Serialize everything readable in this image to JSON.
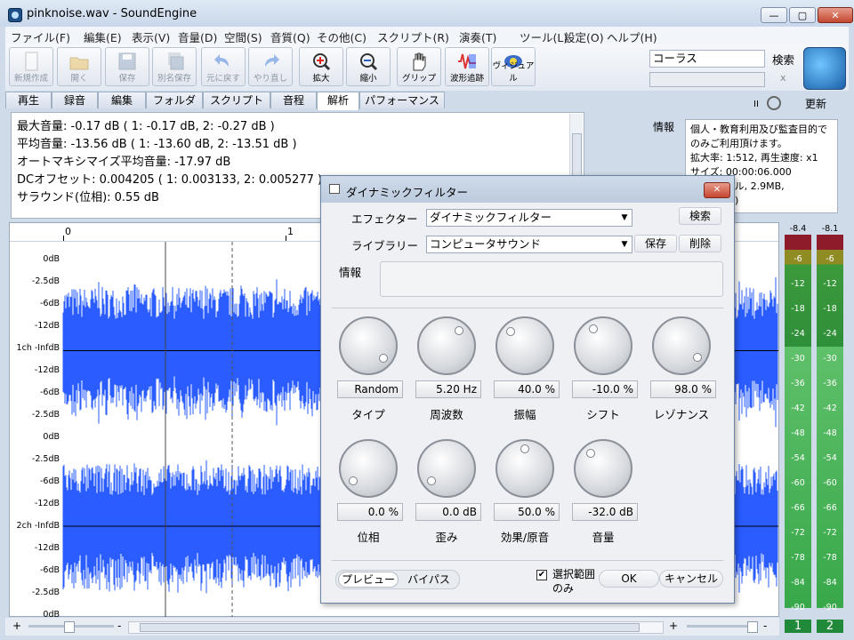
{
  "window": {
    "title": "pinknoise.wav - SoundEngine",
    "min": "—",
    "max": "▢",
    "close": "✕"
  },
  "menu": [
    "ファイル(F)",
    "編集(E)",
    "表示(V)",
    "音量(D)",
    "空間(S)",
    "音質(Q)",
    "その他(C)",
    "スクリプト(R)",
    "演奏(T)",
    "ツール(L)",
    "設定(O)",
    "ヘルプ(H)"
  ],
  "toolbar": {
    "buttons": [
      {
        "label": "新規作成",
        "icon": "new-file-icon",
        "enabled": false
      },
      {
        "label": "開く",
        "icon": "folder-icon",
        "enabled": false
      },
      {
        "label": "保存",
        "icon": "save-icon",
        "enabled": false
      },
      {
        "label": "別名保存",
        "icon": "save-as-icon",
        "enabled": false
      },
      {
        "label": "元に戻す",
        "icon": "undo-icon",
        "enabled": false
      },
      {
        "label": "やり直し",
        "icon": "redo-icon",
        "enabled": false
      },
      {
        "label": "拡大",
        "icon": "zoom-in-icon",
        "enabled": true
      },
      {
        "label": "縮小",
        "icon": "zoom-out-icon",
        "enabled": true
      },
      {
        "label": "グリップ",
        "icon": "hand-icon",
        "enabled": true
      },
      {
        "label": "波形追跡",
        "icon": "waveform-track-icon",
        "enabled": true
      },
      {
        "label": "ヴィジュアル",
        "icon": "visual-icon",
        "enabled": true
      }
    ],
    "search_value": "コーラス",
    "search_label": "検索",
    "clear_label": "x"
  },
  "tabs": [
    "再生",
    "録音",
    "編集",
    "フォルダ",
    "スクリプト",
    "音程",
    "解析",
    "パフォーマンス"
  ],
  "active_tab": "解析",
  "analysis": [
    "最大音量: -0.17 dB ( 1: -0.17 dB, 2: -0.27 dB )",
    "平均音量: -13.56 dB ( 1: -13.60 dB, 2: -13.51 dB )",
    "オートマキシマイズ平均音量: -17.97 dB",
    "DCオフセット: 0.004205 ( 1: 0.003133, 2: 0.005277 )",
    "サラウンド(位相): 0.55 dB"
  ],
  "side": {
    "update_label": "更新",
    "pause_glyph": "II",
    "info_label": "情報",
    "info_lines": [
      "個人・教育利用及び監査目的で",
      "のみご利用頂けます。",
      "拡大率: 1:512, 再生速度: x1",
      "サイズ: 00:00:06.000",
      "        ンプル, 2.9MB,",
      "        イト)"
    ]
  },
  "ruler": [
    "0",
    "1"
  ],
  "wave": {
    "ch1_labels": [
      "0dB",
      "-2.5dB",
      "-6dB",
      "-12dB",
      "1ch -InfdB",
      "-12dB",
      "-6dB",
      "-2.5dB",
      "0dB"
    ],
    "ch2_labels": [
      "-2.5dB",
      "-6dB",
      "-12dB",
      "2ch -InfdB",
      "-12dB",
      "-6dB",
      "-2.5dB",
      "0dB"
    ],
    "color": "#2a5cff"
  },
  "meter": {
    "peaks": [
      "-8.4",
      "-8.1"
    ],
    "scale": [
      "-6",
      "-12",
      "-18",
      "-24",
      "-30",
      "-36",
      "-42",
      "-48",
      "-54",
      "-60",
      "-66",
      "-72",
      "-78",
      "-84",
      "-90"
    ],
    "channels": [
      "1",
      "2"
    ],
    "level_ch1": "-24",
    "level_ch2": "-24"
  },
  "status": {
    "plus": "+",
    "minus": "-"
  },
  "dialog": {
    "title": "ダイナミックフィルター",
    "effector_label": "エフェクター",
    "effector_value": "ダイナミックフィルター",
    "search_label": "検索",
    "library_label": "ライブラリー",
    "library_value": "コンピュータサウンド",
    "save_label": "保存",
    "delete_label": "削除",
    "info_label": "情報",
    "knobs_row1": [
      {
        "name": "タイプ",
        "value": "Random",
        "angle": 130
      },
      {
        "name": "周波数",
        "value": "5.20 Hz",
        "angle": 40
      },
      {
        "name": "振幅",
        "value": "40.0 %",
        "angle": -45
      },
      {
        "name": "シフト",
        "value": "-10.0 %",
        "angle": -30
      },
      {
        "name": "レゾナンス",
        "value": "98.0 %",
        "angle": 125
      }
    ],
    "knobs_row2": [
      {
        "name": "位相",
        "value": "0.0 %",
        "angle": -130
      },
      {
        "name": "歪み",
        "value": "0.0 dB",
        "angle": -130
      },
      {
        "name": "効果/原音",
        "value": "50.0 %",
        "angle": 0
      },
      {
        "name": "音量",
        "value": "-32.0 dB",
        "angle": -40
      }
    ],
    "preview_label": "プレビュー",
    "bypass_label": "バイパス",
    "selection_label": "選択範囲のみ",
    "selection_checked": true,
    "ok_label": "OK",
    "cancel_label": "キャンセル"
  }
}
